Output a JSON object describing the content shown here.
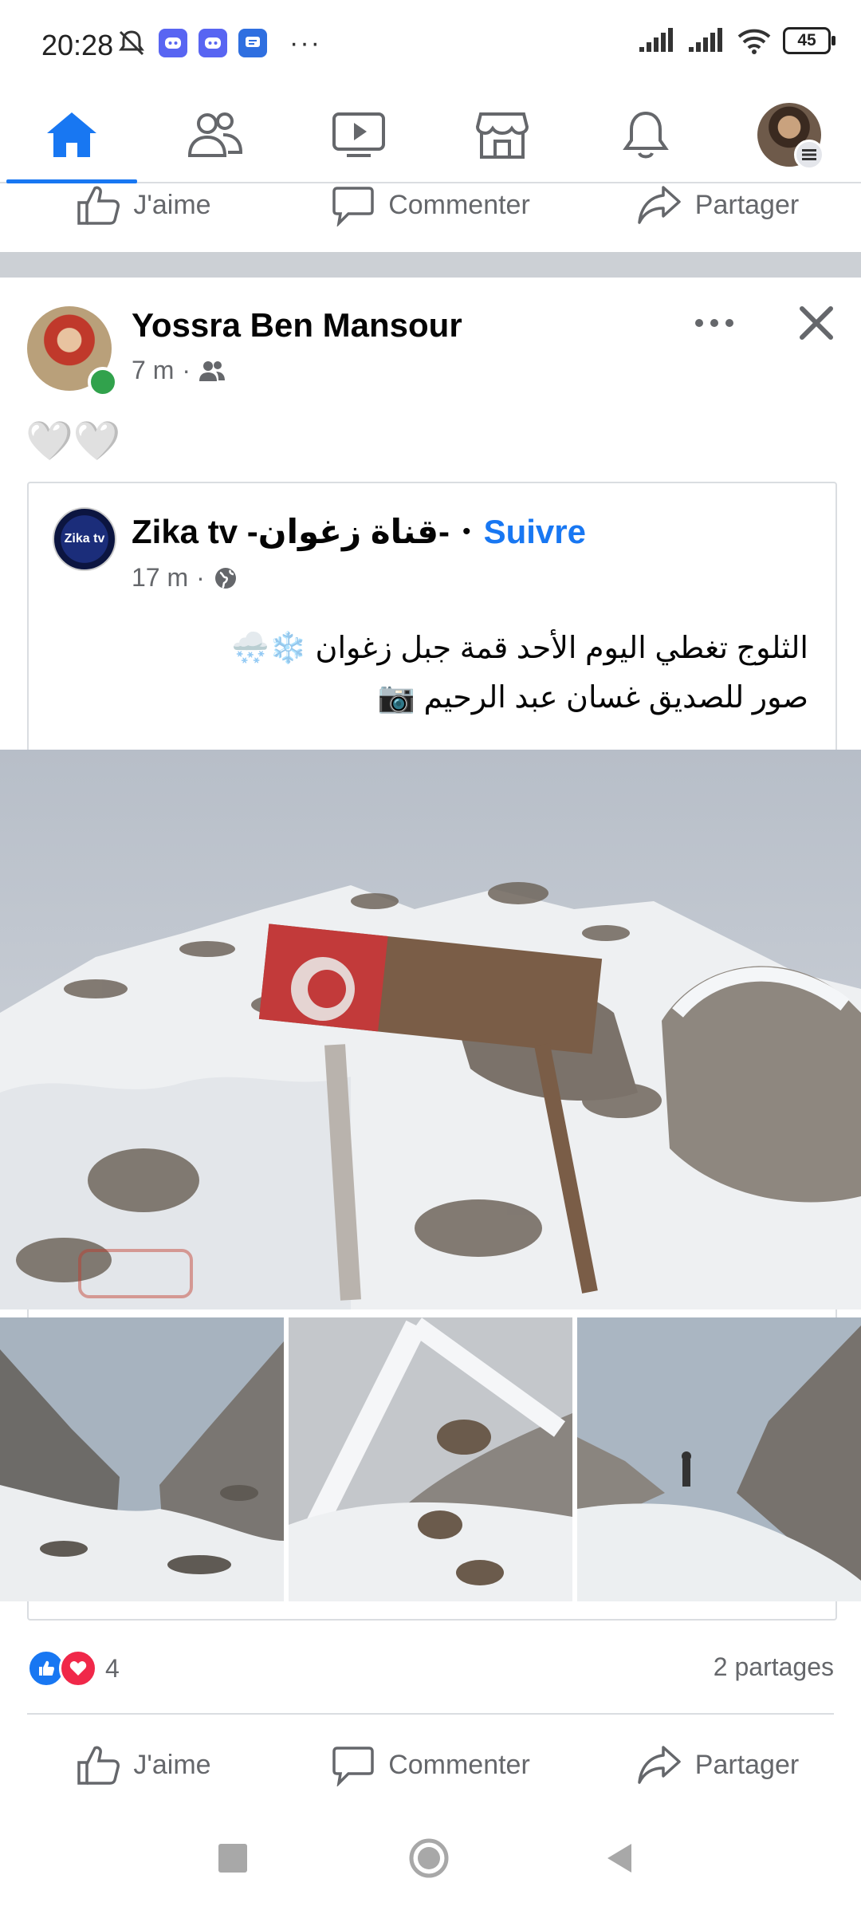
{
  "status_bar": {
    "time": "20:28",
    "battery": "45",
    "overflow": "···"
  },
  "nav": {
    "tabs": [
      "home",
      "friends",
      "watch",
      "marketplace",
      "notifications",
      "profile-menu"
    ],
    "active": "home",
    "accent": "#1877f2"
  },
  "top_actions": {
    "like": "J'aime",
    "comment": "Commenter",
    "share": "Partager"
  },
  "post": {
    "author": "Yossra Ben Mansour",
    "time": "7 m",
    "separator": "·",
    "audience_icon": "friends-icon",
    "reaction_text": "🤍🤍"
  },
  "shared_post": {
    "page_name": "Zika tv -قناة زغوان-",
    "bullet": "•",
    "follow": "Suivre",
    "time": "17 m",
    "separator": "·",
    "audience_icon": "globe-icon",
    "avatar_label": "Zika tv",
    "text_line1": "الثلوج تغطي اليوم الأحد قمة جبل زغوان ❄️🌨️",
    "text_line2": "صور للصديق غسان عبد الرحيم 📷"
  },
  "stats": {
    "reaction_count": "4",
    "shares": "2 partages"
  },
  "bottom_actions": {
    "like": "J'aime",
    "comment": "Commenter",
    "share": "Partager"
  }
}
